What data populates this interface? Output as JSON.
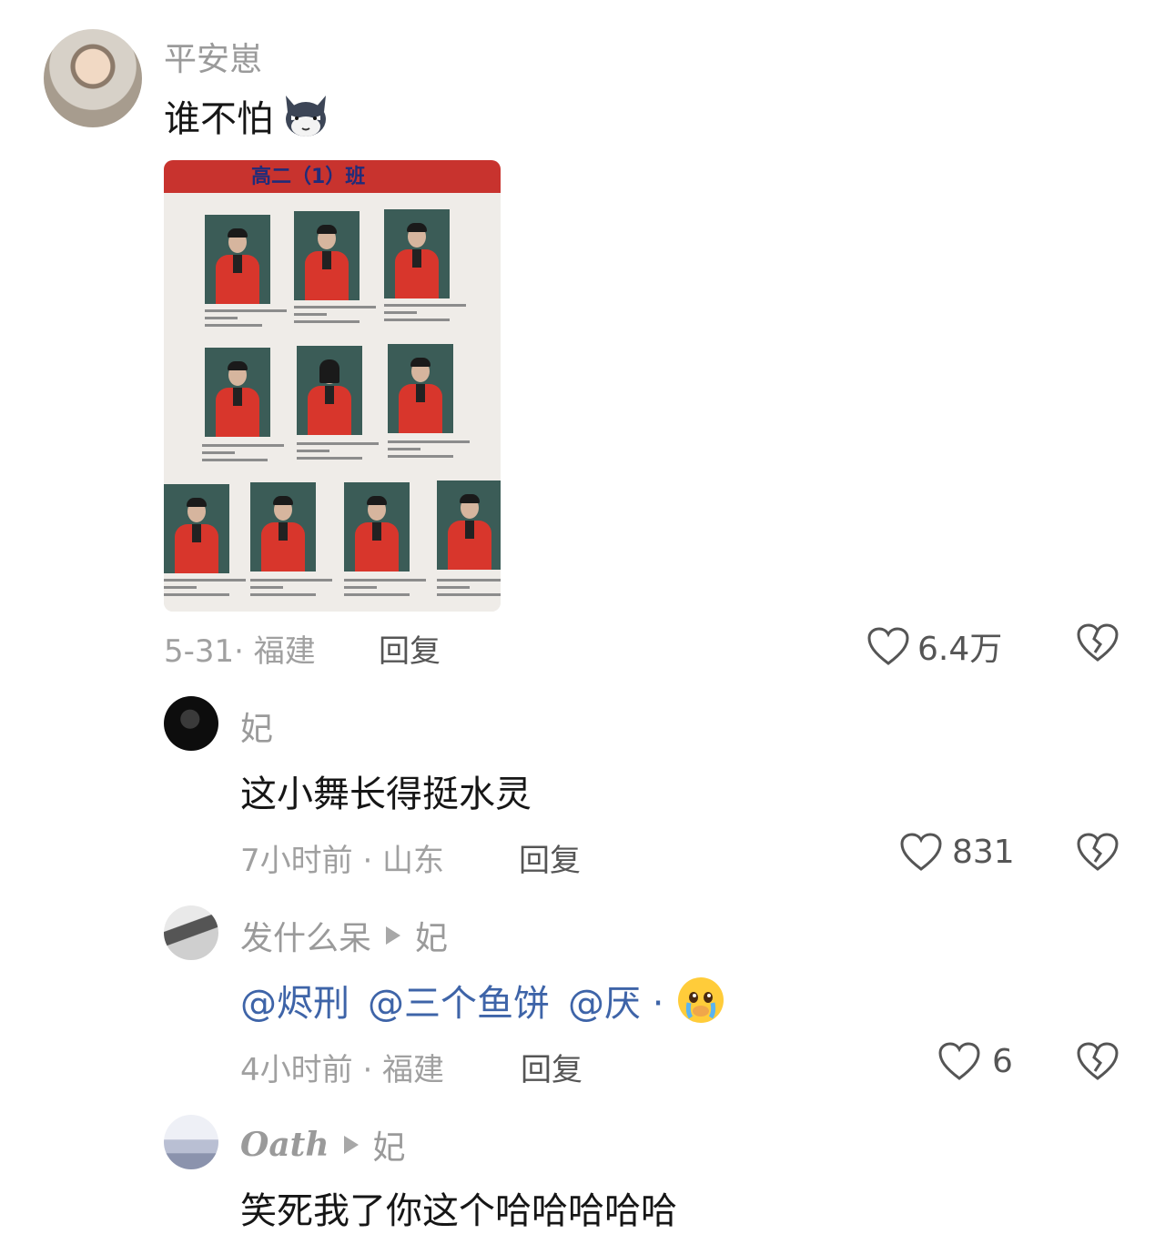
{
  "post": {
    "username": "平安崽",
    "text": "谁不怕",
    "emoji": "sly-cat-emoji",
    "photo_header": "高二（1）班",
    "date_location": "5-31· 福建",
    "reply_label": "回复",
    "likes": "6.4万"
  },
  "replies": [
    {
      "username": "妃",
      "text": "这小舞长得挺水灵",
      "time_location": "7小时前 · 山东",
      "reply_label": "回复",
      "likes": "831"
    },
    {
      "username": "发什么呆",
      "reply_to": "妃",
      "mentions": [
        "@烬刑",
        "@三个鱼饼",
        "@厌 ·"
      ],
      "emoji": "crying-face-emoji",
      "time_location": "4小时前 · 福建",
      "reply_label": "回复",
      "likes": "6"
    },
    {
      "username": "Oath",
      "reply_to": "妃",
      "text": "笑死我了你这个哈哈哈哈哈"
    }
  ],
  "colors": {
    "mention": "#3e64a8",
    "meta_gray": "#a0a0a0",
    "uniform_red": "#d8362c"
  }
}
